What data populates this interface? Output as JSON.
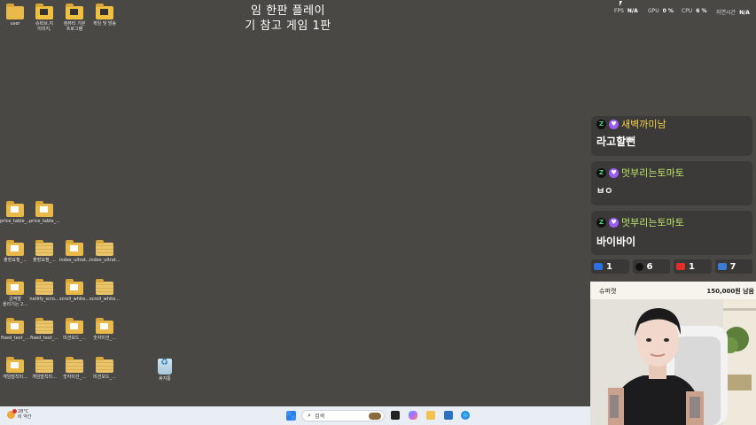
{
  "desktop_icons": [
    {
      "label": "user"
    },
    {
      "label": "슈퍼브.지\n이미지,"
    },
    {
      "label": "컴퓨터 기본\n프로그램"
    },
    {
      "label": "게임 및 방송"
    },
    {
      "label": "price_table_..."
    },
    {
      "label": "price_table_..."
    },
    {
      "label": "출장요청_..."
    },
    {
      "label": "출장요청_..."
    },
    {
      "label": "index_ultrat..."
    },
    {
      "label": "index_ultrat..."
    },
    {
      "label": "금액별\n올리기는 2..."
    },
    {
      "label": "netlify_scro..."
    },
    {
      "label": "scroll_white..."
    },
    {
      "label": "scroll_white..."
    },
    {
      "label": "fixed_text_..."
    },
    {
      "label": "fixed_text_..."
    },
    {
      "label": "미션보드_..."
    },
    {
      "label": "숫자미션_..."
    },
    {
      "label": "게임벌칙미..."
    },
    {
      "label": "게임벌칙미..."
    },
    {
      "label": "숫자미션_..."
    },
    {
      "label": "미션보드_..."
    },
    {
      "label": "휴지통"
    }
  ],
  "overlay": {
    "title_line1": "임 한판 플레이",
    "title_line2": "기 참고 게임 1판"
  },
  "perf": {
    "fps_label": "FPS",
    "fps_value": "N/A",
    "gpu_label": "GPU",
    "gpu_value": "0 %",
    "cpu_label": "CPU",
    "cpu_value": "6 %",
    "latency_label": "지연시간",
    "latency_value": "N/A"
  },
  "chat": [
    {
      "name": "새벽까미남",
      "message": "라고할뻔"
    },
    {
      "name": "멋부리는토마토",
      "message": "ㅂㅇ"
    },
    {
      "name": "멋부리는토마토",
      "message": "바이바이"
    }
  ],
  "viewer_stats": [
    {
      "platform": "link",
      "count": "1",
      "color": "#2b6fe0"
    },
    {
      "platform": "zeta",
      "count": "6",
      "color": "#1fbf5f"
    },
    {
      "platform": "youtube",
      "count": "1",
      "color": "#e52d27"
    },
    {
      "platform": "live",
      "count": "7",
      "color": "#3a7bd5"
    }
  ],
  "donation": {
    "name": "슈퍼캣",
    "amount": "150,000원 남음"
  },
  "taskbar": {
    "weather_temp": "28°C",
    "weather_desc": "비 약간",
    "search_placeholder": "검색"
  }
}
